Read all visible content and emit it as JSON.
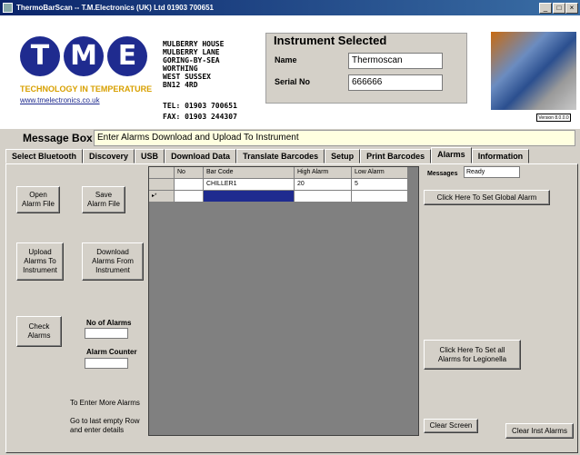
{
  "window": {
    "title": "ThermoBarScan     -- T.M.Electronics (UK) Ltd  01903 700651",
    "controls": [
      "_",
      "□",
      "×"
    ]
  },
  "header": {
    "logo_letters": [
      "T",
      "M",
      "E"
    ],
    "tagline": "TECHNOLOGY IN TEMPERATURE",
    "url": "www.tmelectronics.co.uk",
    "address": [
      "MULBERRY HOUSE",
      "MULBERRY LANE",
      "GORING-BY-SEA",
      "WORTHING",
      "WEST SUSSEX",
      "BN12 4RD"
    ],
    "tel": "TEL:  01903 700651",
    "fax": "FAX:  01903 244307",
    "version": "Version 8.0.0.0"
  },
  "instrument": {
    "title": "Instrument Selected",
    "name_label": "Name",
    "name_value": "Thermoscan",
    "serial_label": "Serial No",
    "serial_value": "666666"
  },
  "message_box": {
    "label": "Message Box",
    "value": "Enter Alarms Download and Upload To Instrument"
  },
  "tabs": [
    {
      "label": "Select Bluetooth"
    },
    {
      "label": "Discovery"
    },
    {
      "label": "USB"
    },
    {
      "label": "Download Data"
    },
    {
      "label": "Translate Barcodes"
    },
    {
      "label": "Setup"
    },
    {
      "label": "Print Barcodes"
    },
    {
      "label": "Alarms",
      "active": true
    },
    {
      "label": "Information"
    }
  ],
  "buttons": {
    "open_alarm_file": "Open\nAlarm File",
    "save_alarm_file": "Save\nAlarm File",
    "upload_alarms": "Upload\nAlarms To\nInstrument",
    "download_alarms": "Download\nAlarms From\nInstrument",
    "check_alarms": "Check\nAlarms",
    "set_global_alarm": "Click Here To Set Global Alarm",
    "set_legionella": "Click Here To Set all\nAlarms for Legionella",
    "clear_screen": "Clear Screen",
    "clear_inst_alarms": "Clear Inst Alarms"
  },
  "labels": {
    "no_of_alarms": "No of Alarms",
    "alarm_counter": "Alarm Counter",
    "hint1": "To Enter More Alarms",
    "hint2": "Go to last empty Row",
    "hint3": "and enter details",
    "messages": "Messages",
    "messages_value": "Ready"
  },
  "grid": {
    "columns": [
      "No",
      "Bar Code",
      "High Alarm",
      "Low Alarm"
    ],
    "rows": [
      {
        "indicator": "",
        "no": "",
        "barcode": "CHILLER1",
        "high": "20",
        "low": "5"
      },
      {
        "indicator": "▸*",
        "no": "",
        "barcode": "",
        "high": "",
        "low": ""
      }
    ]
  }
}
